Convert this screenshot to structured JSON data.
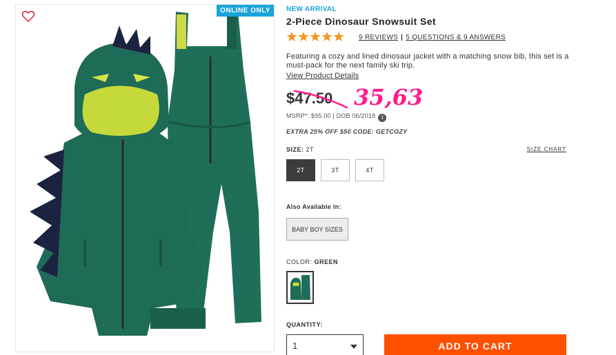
{
  "image_panel": {
    "badge": "ONLINE ONLY",
    "wishlist_icon": "heart-outline-icon",
    "product_image": "green-dinosaur-snowsuit"
  },
  "product": {
    "tag": "NEW ARRIVAL",
    "title": "2-Piece Dinosaur Snowsuit Set",
    "rating": 5,
    "reviews_link": "9 REVIEWS",
    "qa_link": "5 QUESTIONS & 9 ANSWERS",
    "description": "Featuring a cozy and lined dinosaur jacket with a matching snow bib, this set is a must-pack for the next family ski trip.",
    "view_details": "View Product Details"
  },
  "pricing": {
    "price": "$47.50",
    "handwritten_price": "35,63",
    "msrp": "MSRP*: $95.00 | DOB 06/2018",
    "info_icon": "i",
    "promo": "EXTRA 25% OFF $50 CODE: GETCOZY",
    "annotation_color": "#ff1c8d"
  },
  "size": {
    "label": "SIZE:",
    "selected": "2T",
    "chart_link": "SIZE CHART",
    "options": [
      "2T",
      "3T",
      "4T"
    ]
  },
  "also_available": {
    "label": "Also Available In:",
    "option": "BABY BOY SIZES"
  },
  "color": {
    "label": "COLOR:",
    "selected": "GREEN",
    "swatch_color": "#1f6e5a"
  },
  "quantity": {
    "label": "QUANTITY:",
    "value": "1"
  },
  "cart": {
    "button": "ADD TO CART",
    "button_color": "#ff5000"
  },
  "colors": {
    "accent": "#1aa3d9",
    "star": "#f7941d"
  }
}
